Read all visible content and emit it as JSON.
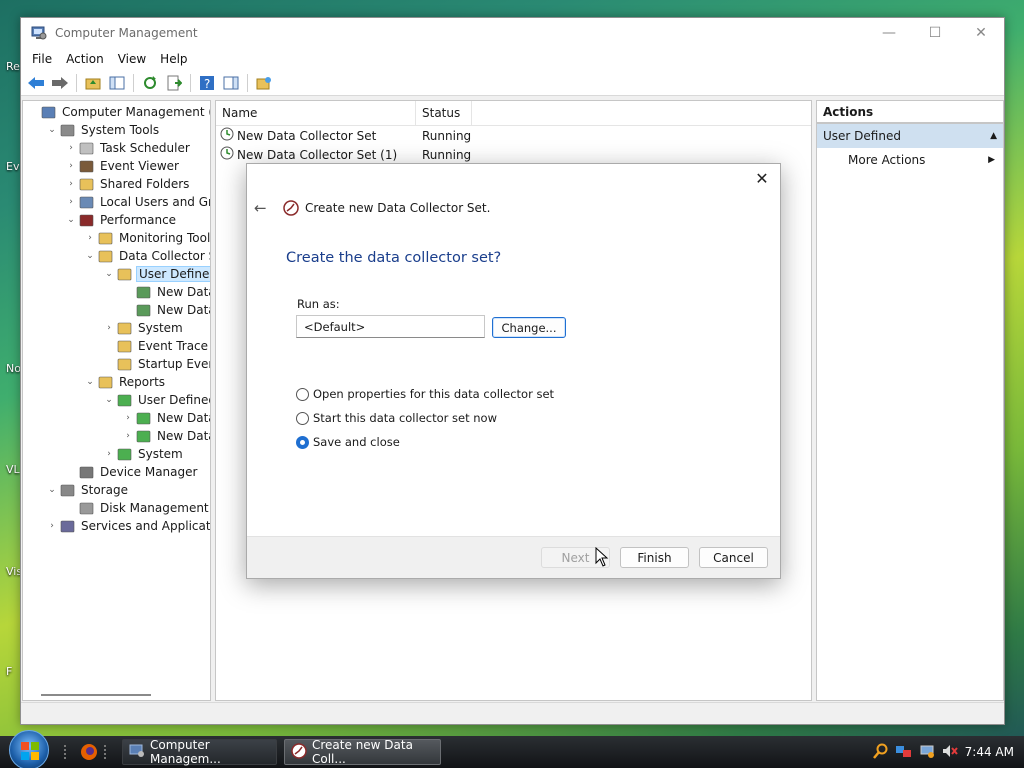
{
  "desktop": {
    "labels": [
      "Re",
      "Ev",
      "No",
      "VL",
      "Vis",
      "F"
    ]
  },
  "window": {
    "title": "Computer Management",
    "controls": {
      "minimize": "—",
      "maximize": "☐",
      "close": "✕"
    }
  },
  "menu": [
    "File",
    "Action",
    "View",
    "Help"
  ],
  "tree": {
    "items": [
      {
        "label": "Computer Management (Local",
        "chev": "",
        "level": 0,
        "icon": "computer-management-icon",
        "selected": false
      },
      {
        "label": "System Tools",
        "chev": "⌄",
        "level": 1,
        "icon": "tools-icon",
        "selected": false
      },
      {
        "label": "Task Scheduler",
        "chev": "›",
        "level": 2,
        "icon": "clock-icon",
        "selected": false
      },
      {
        "label": "Event Viewer",
        "chev": "›",
        "level": 2,
        "icon": "event-viewer-icon",
        "selected": false
      },
      {
        "label": "Shared Folders",
        "chev": "›",
        "level": 2,
        "icon": "shared-folder-icon",
        "selected": false
      },
      {
        "label": "Local Users and Groups",
        "chev": "›",
        "level": 2,
        "icon": "users-icon",
        "selected": false
      },
      {
        "label": "Performance",
        "chev": "⌄",
        "level": 2,
        "icon": "performance-icon",
        "selected": false
      },
      {
        "label": "Monitoring Tools",
        "chev": "›",
        "level": 3,
        "icon": "folder-icon",
        "selected": false
      },
      {
        "label": "Data Collector Sets",
        "chev": "⌄",
        "level": 3,
        "icon": "folder-icon",
        "selected": false
      },
      {
        "label": "User Defined",
        "chev": "⌄",
        "level": 4,
        "icon": "user-folder-icon",
        "selected": true
      },
      {
        "label": "New Data Co",
        "chev": "",
        "level": 5,
        "icon": "data-collector-icon",
        "selected": false
      },
      {
        "label": "New Data Co",
        "chev": "",
        "level": 5,
        "icon": "data-collector-icon",
        "selected": false
      },
      {
        "label": "System",
        "chev": "›",
        "level": 4,
        "icon": "folder-icon",
        "selected": false
      },
      {
        "label": "Event Trace Sess",
        "chev": "",
        "level": 4,
        "icon": "folder-icon",
        "selected": false
      },
      {
        "label": "Startup Event Tra",
        "chev": "",
        "level": 4,
        "icon": "folder-icon",
        "selected": false
      },
      {
        "label": "Reports",
        "chev": "⌄",
        "level": 3,
        "icon": "report-folder-icon",
        "selected": false
      },
      {
        "label": "User Defined",
        "chev": "⌄",
        "level": 4,
        "icon": "report-icon",
        "selected": false
      },
      {
        "label": "New Data Co",
        "chev": "›",
        "level": 5,
        "icon": "report-icon",
        "selected": false
      },
      {
        "label": "New Data Co",
        "chev": "›",
        "level": 5,
        "icon": "report-icon",
        "selected": false
      },
      {
        "label": "System",
        "chev": "›",
        "level": 4,
        "icon": "report-icon",
        "selected": false
      },
      {
        "label": "Device Manager",
        "chev": "",
        "level": 2,
        "icon": "device-manager-icon",
        "selected": false
      },
      {
        "label": "Storage",
        "chev": "⌄",
        "level": 1,
        "icon": "storage-icon",
        "selected": false
      },
      {
        "label": "Disk Management",
        "chev": "",
        "level": 2,
        "icon": "disk-icon",
        "selected": false
      },
      {
        "label": "Services and Applications",
        "chev": "›",
        "level": 1,
        "icon": "services-icon",
        "selected": false
      }
    ]
  },
  "list": {
    "headers": {
      "name": "Name",
      "status": "Status"
    },
    "rows": [
      {
        "name": "New Data Collector Set",
        "status": "Running"
      },
      {
        "name": "New Data Collector Set (1)",
        "status": "Running"
      }
    ]
  },
  "actions": {
    "header": "Actions",
    "section": "User Defined",
    "section_glyph": "▲",
    "item": "More Actions",
    "item_glyph": "▶"
  },
  "dialog": {
    "close": "✕",
    "back": "←",
    "wizard_title": "Create new Data Collector Set.",
    "heading": "Create the data collector set?",
    "runas_label": "Run as:",
    "runas_value": "<Default>",
    "change_button": "Change...",
    "options": [
      {
        "label": "Open properties for this data collector set",
        "checked": false
      },
      {
        "label": "Start this data collector set now",
        "checked": false
      },
      {
        "label": "Save and close",
        "checked": true
      }
    ],
    "buttons": {
      "next": "Next",
      "finish": "Finish",
      "cancel": "Cancel"
    }
  },
  "taskbar": {
    "buttons": [
      {
        "label": "Computer Managem...",
        "active": false
      },
      {
        "label": "Create new Data Coll...",
        "active": true
      }
    ],
    "clock": "7:44 AM"
  }
}
